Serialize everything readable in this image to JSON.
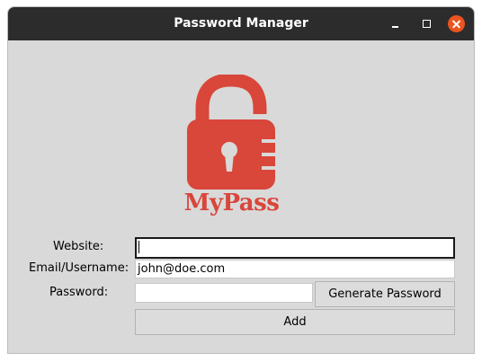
{
  "window": {
    "title": "Password Manager",
    "controls": [
      "minimize-icon",
      "maximize-icon",
      "close-icon"
    ],
    "close_color": "#e95420",
    "titlebar_color": "#2c2c2c"
  },
  "logo": {
    "text": "MyPass",
    "icon": "unlocked-padlock-icon",
    "color": "#d9463a"
  },
  "form": {
    "website_label": "Website:",
    "website_value": "",
    "email_label": "Email/Username:",
    "email_value": "john@doe.com",
    "password_label": "Password:",
    "password_value": "",
    "generate_label": "Generate Password",
    "add_label": "Add"
  }
}
